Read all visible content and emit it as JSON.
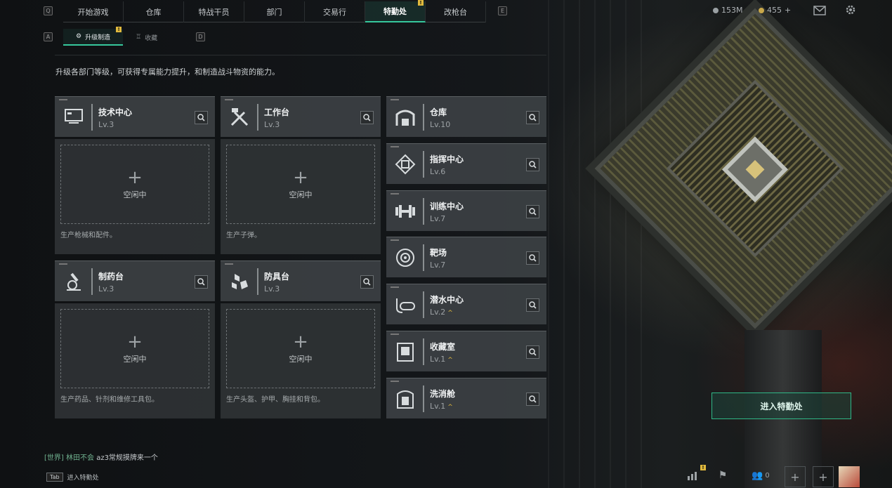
{
  "nav": {
    "key_left": "Q",
    "key_right": "E",
    "tabs": [
      {
        "label": "开始游戏"
      },
      {
        "label": "仓库"
      },
      {
        "label": "特战干员"
      },
      {
        "label": "部门"
      },
      {
        "label": "交易行"
      },
      {
        "label": "特勤处",
        "active": true,
        "badge": "!"
      },
      {
        "label": "改枪台"
      }
    ]
  },
  "resources": {
    "currency": "153M",
    "coins": "455",
    "coins_plus": "+"
  },
  "subnav": {
    "key_left": "A",
    "key_right": "D",
    "tabs": [
      {
        "label": "升级制造",
        "active": true,
        "badge": "!"
      },
      {
        "label": "收藏"
      }
    ]
  },
  "description": "升级各部门等级，可获得专属能力提升，和制造战斗物资的能力。",
  "workshops": [
    {
      "name": "技术中心",
      "level": "Lv.3",
      "icon": "computer-icon",
      "slot_plus": "+",
      "slot_status": "空闲中",
      "footer": "生产枪械和配件。"
    },
    {
      "name": "工作台",
      "level": "Lv.3",
      "icon": "tools-icon",
      "slot_plus": "+",
      "slot_status": "空闲中",
      "footer": "生产子弹。"
    },
    {
      "name": "制药台",
      "level": "Lv.3",
      "icon": "microscope-icon",
      "slot_plus": "+",
      "slot_status": "空闲中",
      "footer": "生产药品、针剂和维修工具包。"
    },
    {
      "name": "防具台",
      "level": "Lv.3",
      "icon": "armor-boxes-icon",
      "slot_plus": "+",
      "slot_status": "空闲中",
      "footer": "生产头盔、护甲、胸挂和背包。"
    }
  ],
  "facilities": [
    {
      "name": "仓库",
      "level": "Lv.10",
      "icon": "warehouse-icon"
    },
    {
      "name": "指挥中心",
      "level": "Lv.6",
      "icon": "command-chip-icon"
    },
    {
      "name": "训练中心",
      "level": "Lv.7",
      "icon": "dumbbell-icon"
    },
    {
      "name": "靶场",
      "level": "Lv.7",
      "icon": "target-icon"
    },
    {
      "name": "潜水中心",
      "level": "Lv.2",
      "icon": "diving-mask-icon",
      "upgrade": "^"
    },
    {
      "name": "收藏室",
      "level": "Lv.1",
      "icon": "collection-room-icon",
      "upgrade": "^"
    },
    {
      "name": "洗消舱",
      "level": "Lv.1",
      "icon": "decon-chamber-icon",
      "upgrade": "^"
    }
  ],
  "enter_button": "进入特勤处",
  "chat": {
    "channel": "[世界]",
    "user": "林田不会",
    "message": "az3常规摸牌来一个"
  },
  "tab_hint": {
    "key": "Tab",
    "label": "进入特勤处"
  },
  "bottom": {
    "friends_count": "0",
    "stats_badge": "!"
  },
  "colors": {
    "accent": "#36c79c",
    "badge": "#e0b93d"
  }
}
